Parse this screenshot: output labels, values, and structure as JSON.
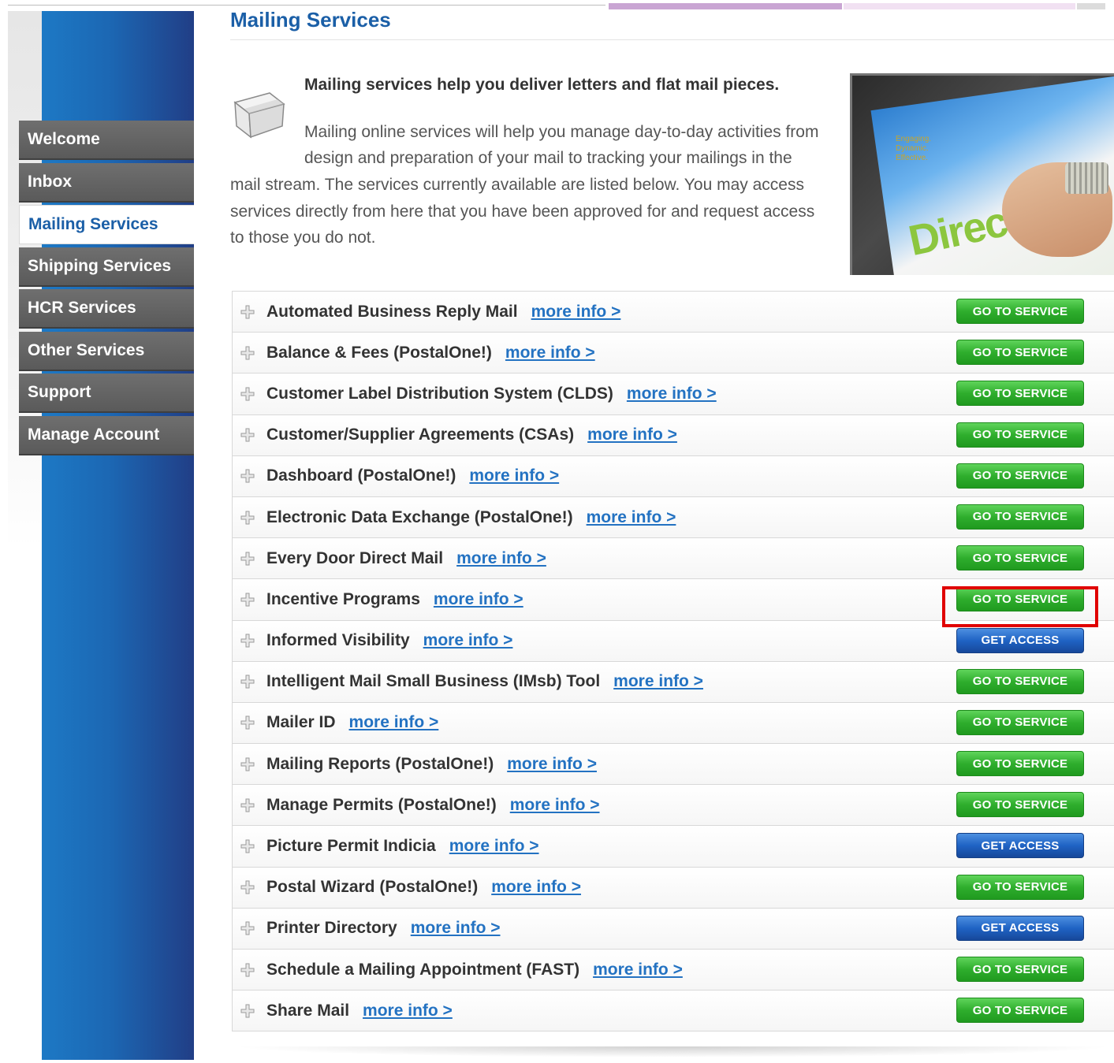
{
  "page": {
    "title": "Mailing Services",
    "intro_heading": "Mailing services help you deliver letters and flat mail pieces.",
    "intro_lines": [
      "Mailing online services will help you manage day-to-day activities from",
      "design and preparation of your mail to tracking your mailings in the",
      "mail stream. The services currently available are listed below. You may access",
      "services directly from here that you have been approved for and request access",
      "to those you do not."
    ]
  },
  "promo": {
    "brand_text": "DirectMail",
    "tagline": [
      "Engaging.",
      "Dynamic.",
      "Effective."
    ]
  },
  "sidebar": {
    "items": [
      {
        "label": "Welcome",
        "active": false
      },
      {
        "label": "Inbox",
        "active": false
      },
      {
        "label": "Mailing Services",
        "active": true
      },
      {
        "label": "Shipping Services",
        "active": false
      },
      {
        "label": "HCR Services",
        "active": false
      },
      {
        "label": "Other Services",
        "active": false
      },
      {
        "label": "Support",
        "active": false
      },
      {
        "label": "Manage Account",
        "active": false
      }
    ]
  },
  "labels": {
    "more_info": "more info >",
    "go_to_service": "GO TO SERVICE",
    "get_access": "GET ACCESS"
  },
  "services": [
    {
      "name": "Automated Business Reply Mail",
      "action": "go"
    },
    {
      "name": "Balance & Fees (PostalOne!)",
      "action": "go"
    },
    {
      "name": "Customer Label Distribution System (CLDS)",
      "action": "go"
    },
    {
      "name": "Customer/Supplier Agreements (CSAs)",
      "action": "go"
    },
    {
      "name": "Dashboard (PostalOne!)",
      "action": "go"
    },
    {
      "name": "Electronic Data Exchange (PostalOne!)",
      "action": "go"
    },
    {
      "name": "Every Door Direct Mail",
      "action": "go"
    },
    {
      "name": "Incentive Programs",
      "action": "go",
      "highlighted": true
    },
    {
      "name": "Informed Visibility",
      "action": "access"
    },
    {
      "name": "Intelligent Mail Small Business (IMsb) Tool",
      "action": "go"
    },
    {
      "name": "Mailer ID",
      "action": "go"
    },
    {
      "name": "Mailing Reports (PostalOne!)",
      "action": "go"
    },
    {
      "name": "Manage Permits (PostalOne!)",
      "action": "go"
    },
    {
      "name": "Picture Permit Indicia",
      "action": "access"
    },
    {
      "name": "Postal Wizard (PostalOne!)",
      "action": "go"
    },
    {
      "name": "Printer Directory",
      "action": "access"
    },
    {
      "name": "Schedule a Mailing Appointment (FAST)",
      "action": "go"
    },
    {
      "name": "Share Mail",
      "action": "go"
    }
  ],
  "colors": {
    "brand_blue": "#1b5fa7",
    "link_blue": "#2372c2",
    "go_green": "#2fae2d",
    "access_blue": "#1f63c4",
    "highlight_red": "#e00000"
  },
  "icons": {
    "intro": "mail-box-icon",
    "row_expand": "plus-expand-icon"
  }
}
